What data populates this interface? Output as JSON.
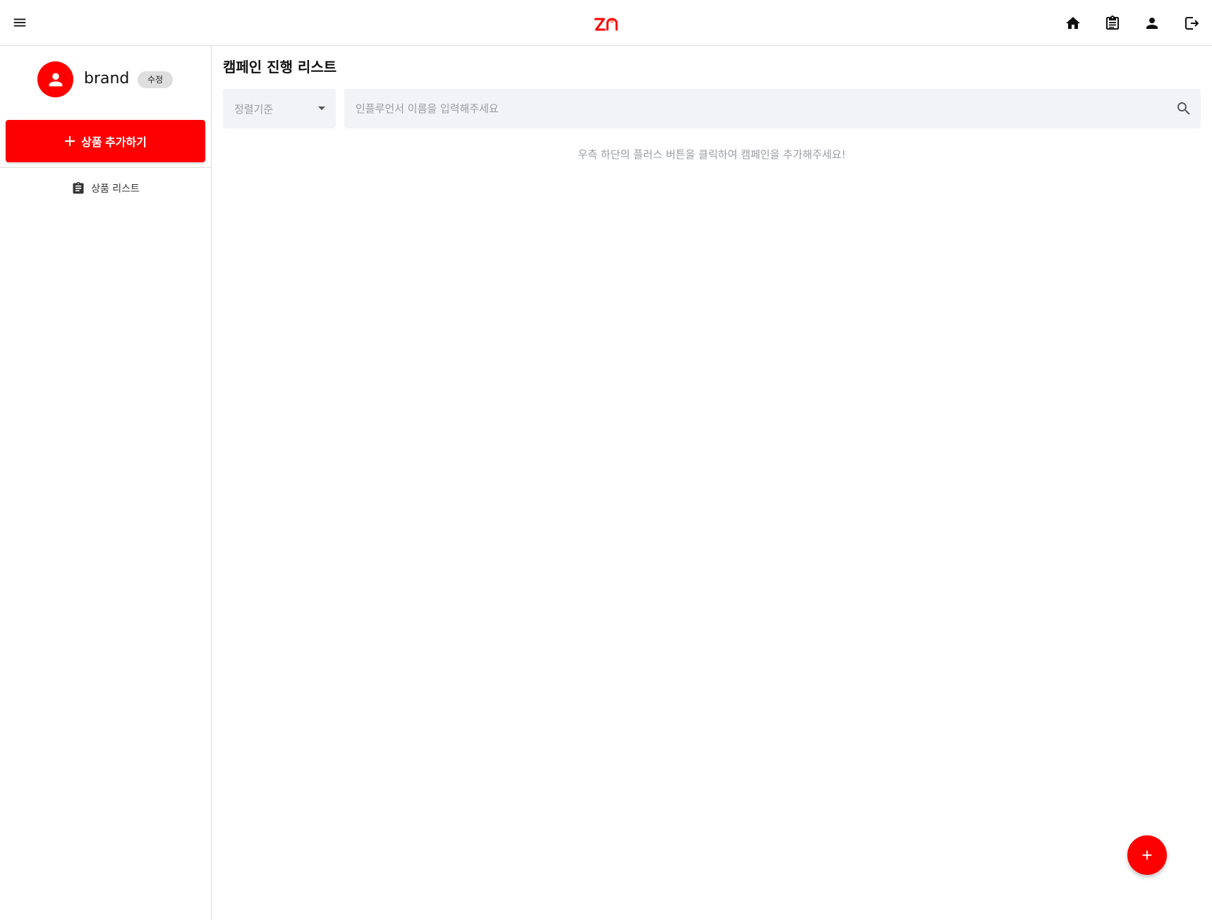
{
  "header": {
    "logo_text": "ZN",
    "icons": [
      "menu-icon",
      "home-icon",
      "clipboard-icon",
      "person-icon",
      "logout-icon"
    ]
  },
  "sidebar": {
    "profile": {
      "name": "brand",
      "edit_label": "수정"
    },
    "add_product_label": "상품 추가하기",
    "items": [
      {
        "label": "상품 리스트",
        "icon": "clipboard-icon"
      }
    ]
  },
  "main": {
    "title": "캠페인 진행 리스트",
    "sort": {
      "label": "정렬기준"
    },
    "search": {
      "placeholder": "인플루언서 이름을 입력해주세요"
    },
    "empty_message": "우측 하단의 플러스 버튼을 클릭하여 캠페인을 추가해주세요!",
    "fab_label": "+"
  },
  "colors": {
    "accent": "#ff0000",
    "field_bg": "#f1f3f7",
    "muted_text": "#9a9ca2",
    "border": "#dcdcdc"
  }
}
